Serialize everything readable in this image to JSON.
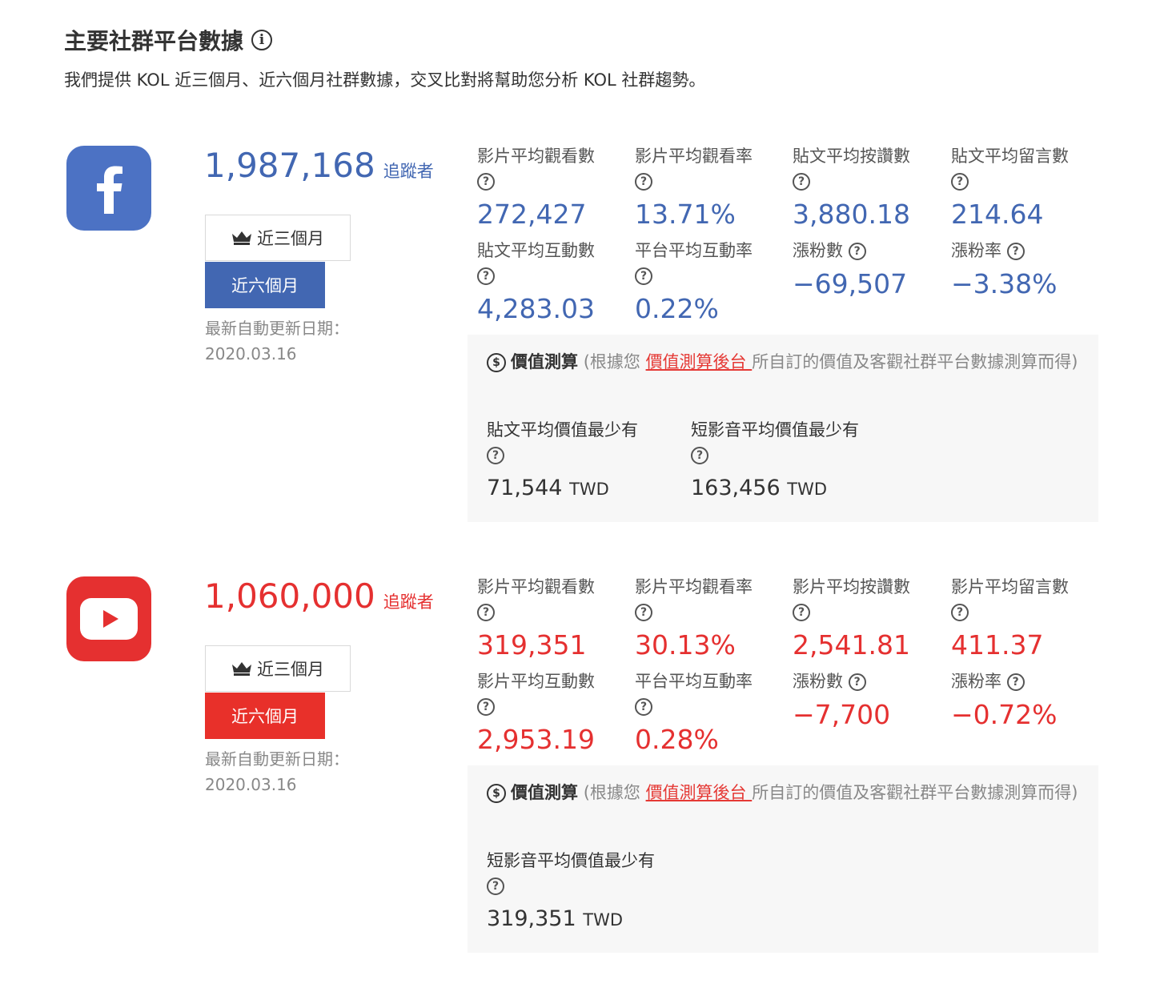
{
  "header": {
    "title": "主要社群平台數據",
    "subtitle": "我們提供 KOL 近三個月、近六個月社群數據，交叉比對將幫助您分析 KOL 社群趨勢。"
  },
  "colors": {
    "facebook": "#4267b2",
    "youtube": "#e53030"
  },
  "facebook": {
    "logo_icon": "facebook-f-icon",
    "followers": "1,987,168",
    "followers_label": "追蹤者",
    "btn_3m": "近三個月",
    "btn_6m": "近六個月",
    "update_label": "最新自動更新日期：",
    "update_date": "2020.03.16",
    "metrics": [
      {
        "label": "影片平均觀看數",
        "value": "272,427"
      },
      {
        "label": "影片平均觀看率",
        "value": "13.71%"
      },
      {
        "label": "貼文平均按讚數",
        "value": "3,880.18"
      },
      {
        "label": "貼文平均留言數",
        "value": "214.64"
      },
      {
        "label": "貼文平均互動數",
        "value": "4,283.03"
      },
      {
        "label": "平台平均互動率",
        "value": "0.22%"
      },
      {
        "label": "漲粉數",
        "value": "−69,507"
      },
      {
        "label": "漲粉率",
        "value": "−3.38%"
      }
    ],
    "value_box": {
      "title": "價值測算",
      "desc_before": "(根據您 ",
      "link": "價值測算後台 ",
      "desc_after": "所自訂的價值及客觀社群平台數據測算而得)",
      "items": [
        {
          "label": "貼文平均價值最少有",
          "value": "71,544",
          "unit": "TWD"
        },
        {
          "label": "短影音平均價值最少有",
          "value": "163,456",
          "unit": "TWD"
        }
      ]
    }
  },
  "youtube": {
    "logo_icon": "youtube-play-icon",
    "followers": "1,060,000",
    "followers_label": "追蹤者",
    "btn_3m": "近三個月",
    "btn_6m": "近六個月",
    "update_label": "最新自動更新日期：",
    "update_date": "2020.03.16",
    "metrics": [
      {
        "label": "影片平均觀看數",
        "value": "319,351"
      },
      {
        "label": "影片平均觀看率",
        "value": "30.13%"
      },
      {
        "label": "影片平均按讚數",
        "value": "2,541.81"
      },
      {
        "label": "影片平均留言數",
        "value": "411.37"
      },
      {
        "label": "影片平均互動數",
        "value": "2,953.19"
      },
      {
        "label": "平台平均互動率",
        "value": "0.28%"
      },
      {
        "label": "漲粉數",
        "value": "−7,700"
      },
      {
        "label": "漲粉率",
        "value": "−0.72%"
      }
    ],
    "value_box": {
      "title": "價值測算",
      "desc_before": "(根據您 ",
      "link": "價值測算後台 ",
      "desc_after": "所自訂的價值及客觀社群平台數據測算而得)",
      "items": [
        {
          "label": "短影音平均價值最少有",
          "value": "319,351",
          "unit": "TWD"
        }
      ]
    }
  }
}
